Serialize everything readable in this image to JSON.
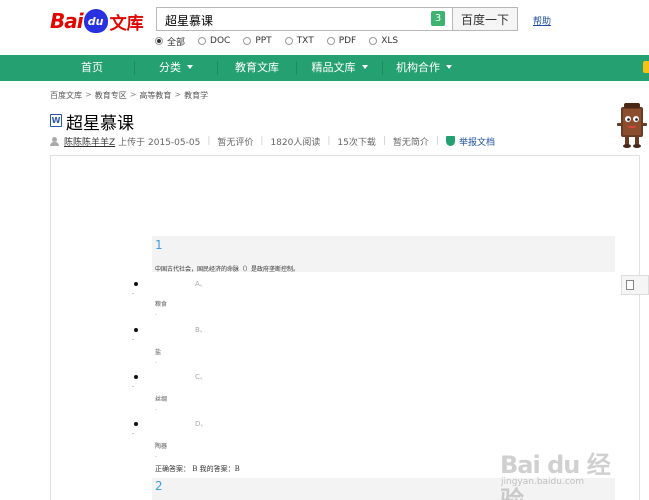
{
  "header": {
    "logo_text": "Bai",
    "logo_paw": "du",
    "logo_suffix": "文库",
    "search_value": "超星慕课",
    "search_count": "3",
    "search_button": "百度一下",
    "help_link": "帮助",
    "filters": [
      {
        "label": "全部",
        "selected": true
      },
      {
        "label": "DOC",
        "selected": false
      },
      {
        "label": "PPT",
        "selected": false
      },
      {
        "label": "TXT",
        "selected": false
      },
      {
        "label": "PDF",
        "selected": false
      },
      {
        "label": "XLS",
        "selected": false
      }
    ]
  },
  "nav": {
    "items": [
      {
        "label": "首页"
      },
      {
        "label": "分类"
      },
      {
        "label": "教育文库"
      },
      {
        "label": "精品文库"
      },
      {
        "label": "机构合作"
      }
    ],
    "accent_color": "#25a071"
  },
  "breadcrumb": {
    "items": [
      "百度文库",
      "教育专区",
      "高等教育",
      "教育学"
    ],
    "separator": ">"
  },
  "doc": {
    "title": "超星慕课",
    "author": "陈陈陈羊羊Z",
    "uploaded": "上传于 2015-05-05",
    "rating": "暂无评价",
    "reads": "1820人阅读",
    "downloads": "15次下载",
    "summary": "暂无简介",
    "report": "举报文档"
  },
  "content": {
    "q1_number": "1",
    "q1_text": "中国古代社会，国民经济的命脉（）是政府垄断控制。",
    "options": [
      {
        "letter": "A、",
        "text": "粮食"
      },
      {
        "letter": "B、",
        "text": "盐"
      },
      {
        "letter": "C、",
        "text": "丝绸"
      },
      {
        "letter": "D、",
        "text": "陶器"
      }
    ],
    "answer": "正确答案： B 我的答案：B",
    "q2_number": "2"
  },
  "watermark": {
    "text": "Bai du 经验",
    "url": "jingyan.baidu.com"
  }
}
